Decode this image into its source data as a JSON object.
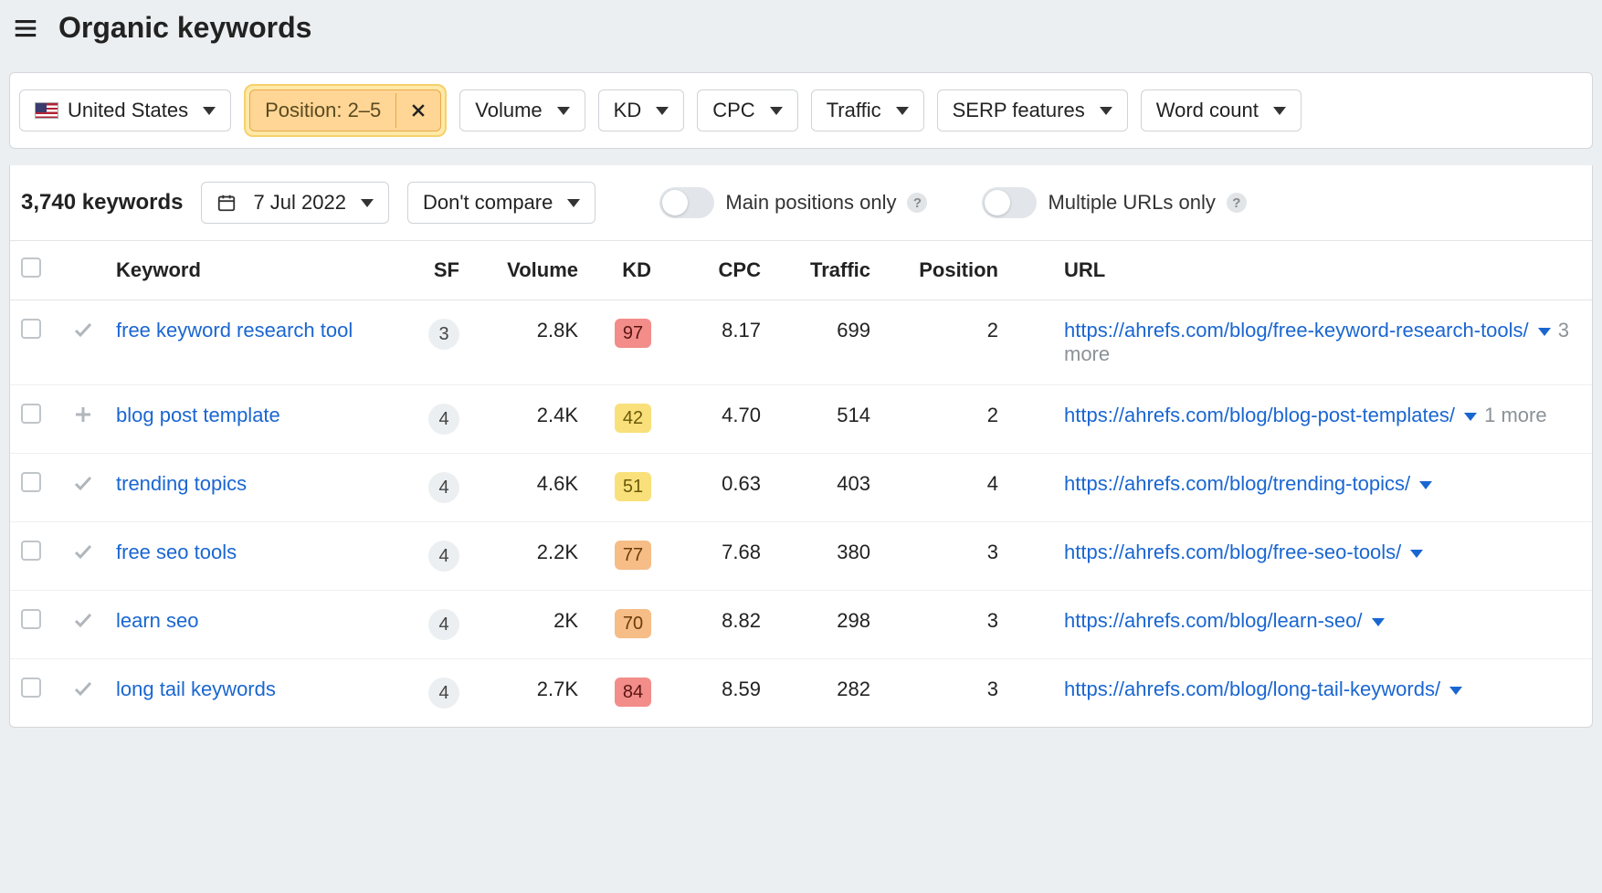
{
  "header": {
    "title": "Organic keywords"
  },
  "filters": {
    "country": "United States",
    "position": "Position: 2–5",
    "volume": "Volume",
    "kd": "KD",
    "cpc": "CPC",
    "traffic": "Traffic",
    "serp_features": "SERP features",
    "word_count": "Word count"
  },
  "toolbar": {
    "keyword_count": "3,740 keywords",
    "date": "7 Jul 2022",
    "compare": "Don't compare",
    "main_positions": "Main positions only",
    "multiple_urls": "Multiple URLs only"
  },
  "columns": {
    "keyword": "Keyword",
    "sf": "SF",
    "volume": "Volume",
    "kd": "KD",
    "cpc": "CPC",
    "traffic": "Traffic",
    "position": "Position",
    "url": "URL"
  },
  "rows": [
    {
      "status": "check",
      "keyword": "free keyword research tool",
      "sf": "3",
      "volume": "2.8K",
      "kd": "97",
      "kd_class": "kd-red",
      "cpc": "8.17",
      "traffic": "699",
      "position": "2",
      "url": "https://ahrefs.com/blog/free-keyword-research-tools/",
      "more": "3 more"
    },
    {
      "status": "plus",
      "keyword": "blog post template",
      "sf": "4",
      "volume": "2.4K",
      "kd": "42",
      "kd_class": "kd-yellow",
      "cpc": "4.70",
      "traffic": "514",
      "position": "2",
      "url": "https://ahrefs.com/blog/blog-post-templates/",
      "more": "1 more"
    },
    {
      "status": "check",
      "keyword": "trending topics",
      "sf": "4",
      "volume": "4.6K",
      "kd": "51",
      "kd_class": "kd-yellow",
      "cpc": "0.63",
      "traffic": "403",
      "position": "4",
      "url": "https://ahrefs.com/blog/trending-topics/",
      "more": ""
    },
    {
      "status": "check",
      "keyword": "free seo tools",
      "sf": "4",
      "volume": "2.2K",
      "kd": "77",
      "kd_class": "kd-orange",
      "cpc": "7.68",
      "traffic": "380",
      "position": "3",
      "url": "https://ahrefs.com/blog/free-seo-tools/",
      "more": ""
    },
    {
      "status": "check",
      "keyword": "learn seo",
      "sf": "4",
      "volume": "2K",
      "kd": "70",
      "kd_class": "kd-orange",
      "cpc": "8.82",
      "traffic": "298",
      "position": "3",
      "url": "https://ahrefs.com/blog/learn-seo/",
      "more": ""
    },
    {
      "status": "check",
      "keyword": "long tail keywords",
      "sf": "4",
      "volume": "2.7K",
      "kd": "84",
      "kd_class": "kd-red",
      "cpc": "8.59",
      "traffic": "282",
      "position": "3",
      "url": "https://ahrefs.com/blog/long-tail-keywords/",
      "more": ""
    }
  ]
}
